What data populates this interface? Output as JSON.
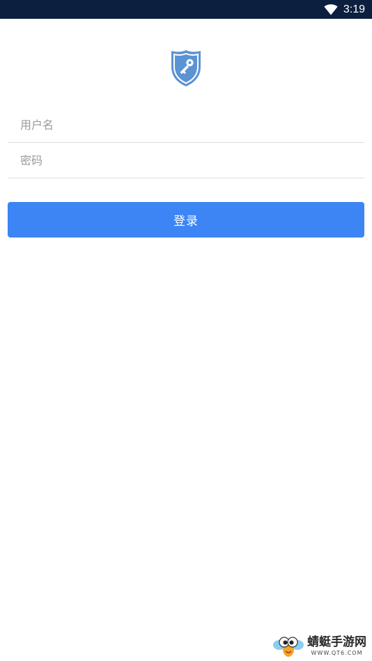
{
  "status_bar": {
    "time": "3:19",
    "wifi_icon": "wifi-icon",
    "background": "#0c1f3f"
  },
  "logo": {
    "icon": "shield-key-icon",
    "color": "#5b93d3"
  },
  "form": {
    "username_placeholder": "用户名",
    "username_value": "",
    "password_placeholder": "密码",
    "password_value": "",
    "login_label": "登录",
    "accent": "#3d84f5"
  },
  "watermark": {
    "title": "蜻蜓手游网",
    "url": "WWW.QT6.COM",
    "icon": "dragonfly-mascot-icon"
  }
}
